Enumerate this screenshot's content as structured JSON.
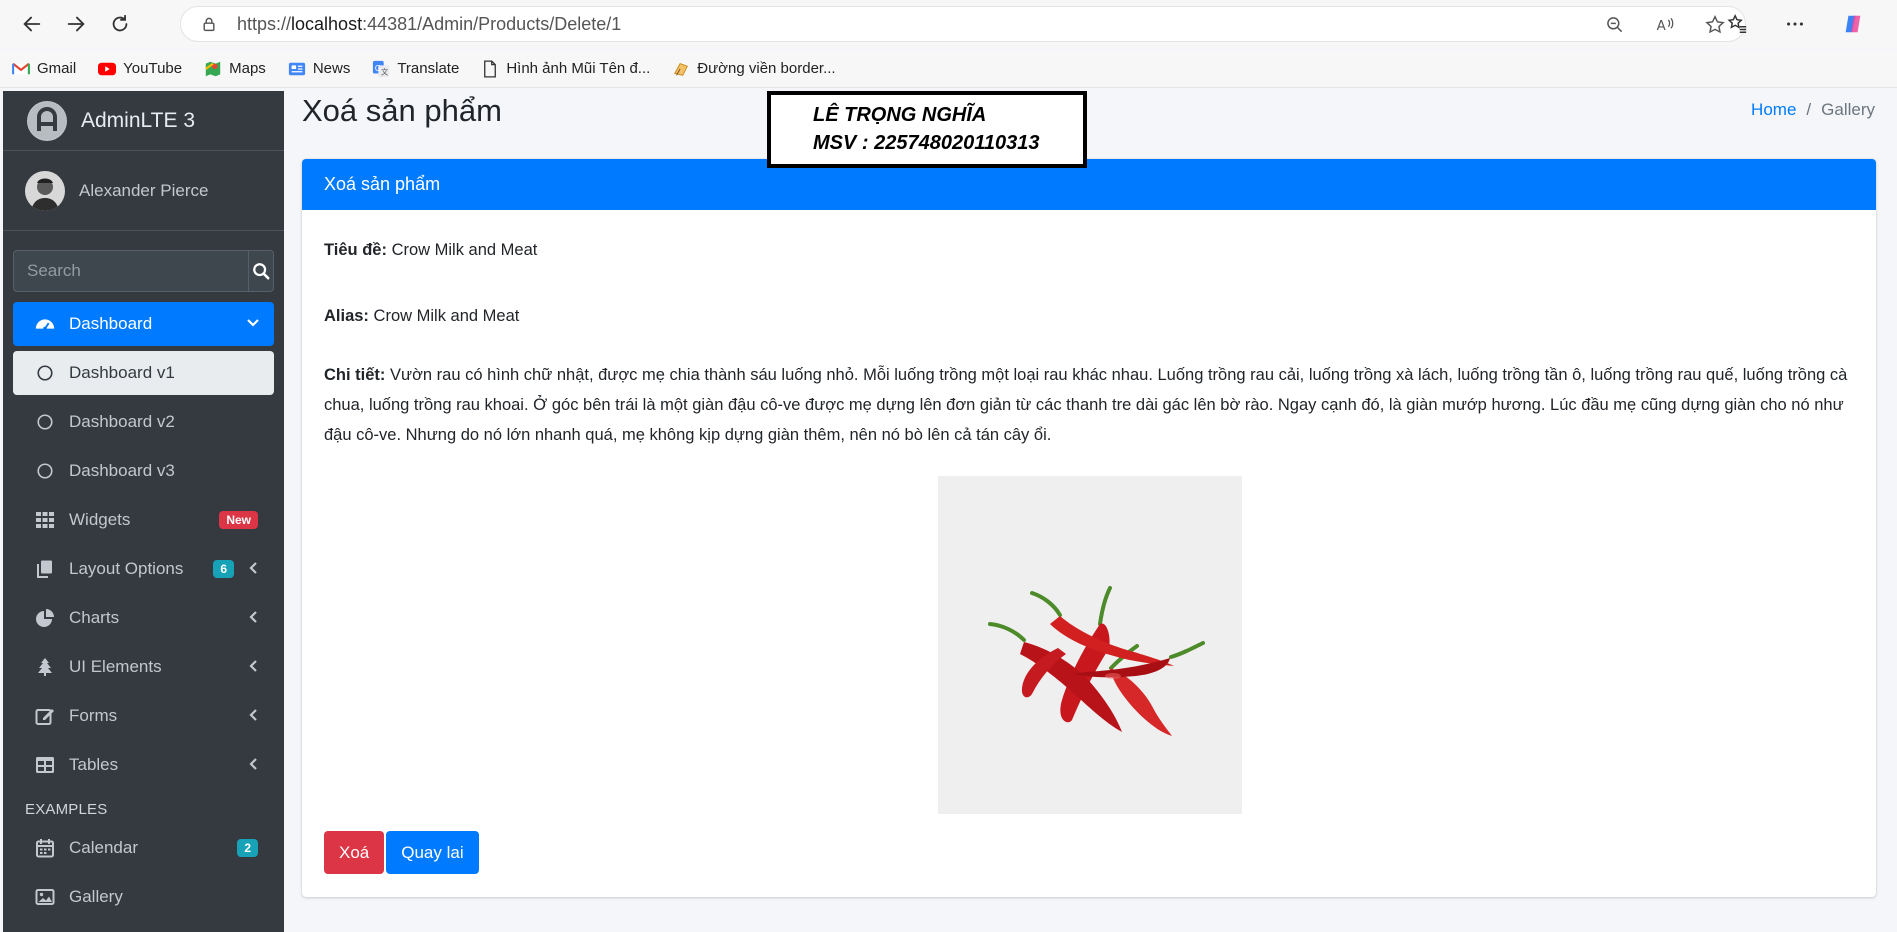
{
  "browser": {
    "url_prefix": "https://",
    "url_host": "localhost",
    "url_rest": ":44381/Admin/Products/Delete/1",
    "bookmarks": [
      {
        "label": "Gmail",
        "icon": "gmail-icon"
      },
      {
        "label": "YouTube",
        "icon": "youtube-icon"
      },
      {
        "label": "Maps",
        "icon": "maps-icon"
      },
      {
        "label": "News",
        "icon": "news-icon"
      },
      {
        "label": "Translate",
        "icon": "translate-icon"
      },
      {
        "label": "Hình ảnh Mũi Tên đ...",
        "icon": "page-icon"
      },
      {
        "label": "Đường viền border...",
        "icon": "bookmark-image-icon"
      }
    ]
  },
  "sidebar": {
    "brand": "AdminLTE 3",
    "user": "Alexander Pierce",
    "search_placeholder": "Search",
    "items": [
      {
        "label": "Dashboard",
        "icon": "tachometer-icon"
      },
      {
        "label": "Dashboard v1",
        "icon": "circle-icon"
      },
      {
        "label": "Dashboard v2",
        "icon": "circle-icon"
      },
      {
        "label": "Dashboard v3",
        "icon": "circle-icon"
      },
      {
        "label": "Widgets",
        "icon": "grid-icon",
        "badge": "New"
      },
      {
        "label": "Layout Options",
        "icon": "copy-icon",
        "badge": "6"
      },
      {
        "label": "Charts",
        "icon": "pie-chart-icon"
      },
      {
        "label": "UI Elements",
        "icon": "tree-icon"
      },
      {
        "label": "Forms",
        "icon": "edit-icon"
      },
      {
        "label": "Tables",
        "icon": "table-icon"
      }
    ],
    "header_examples": "EXAMPLES",
    "examples": [
      {
        "label": "Calendar",
        "icon": "calendar-icon",
        "badge": "2"
      },
      {
        "label": "Gallery",
        "icon": "image-icon"
      }
    ]
  },
  "content": {
    "title": "Xoá sản phẩm",
    "breadcrumb": {
      "home": "Home",
      "sep": "/",
      "current": "Gallery"
    },
    "watermark": {
      "line1": "LÊ TRỌNG NGHĨA",
      "line2": "MSV : 225748020110313"
    },
    "card_title": "Xoá sản phẩm",
    "fields": {
      "title_label": "Tiêu đề:",
      "title_value": "Crow Milk and Meat",
      "alias_label": "Alias:",
      "alias_value": "Crow Milk and Meat",
      "detail_label": "Chi tiết:",
      "detail_value": "Vườn rau có hình chữ nhật, được mẹ chia thành sáu luống nhỏ. Mỗi luống trồng một loại rau khác nhau. Luống trồng rau cải, luống trồng xà lách, luống trồng tần ô, luống trồng rau quế, luống trồng cà chua, luống trồng rau khoai. Ở góc bên trái là một giàn đậu cô-ve được mẹ dựng lên đơn giản từ các thanh tre dài gác lên bờ rào. Ngay cạnh đó, là giàn mướp hương. Lúc đầu mẹ cũng dựng giàn cho nó như đậu cô-ve. Nhưng do nó lớn nhanh quá, mẹ không kịp dựng giàn thêm, nên nó bò lên cả tán cây ổi."
    },
    "buttons": {
      "delete": "Xoá",
      "back": "Quay lai"
    }
  },
  "colors": {
    "primary": "#007bff",
    "danger": "#dc3545",
    "sidebar": "#343a40",
    "teal": "#17a2b8"
  }
}
